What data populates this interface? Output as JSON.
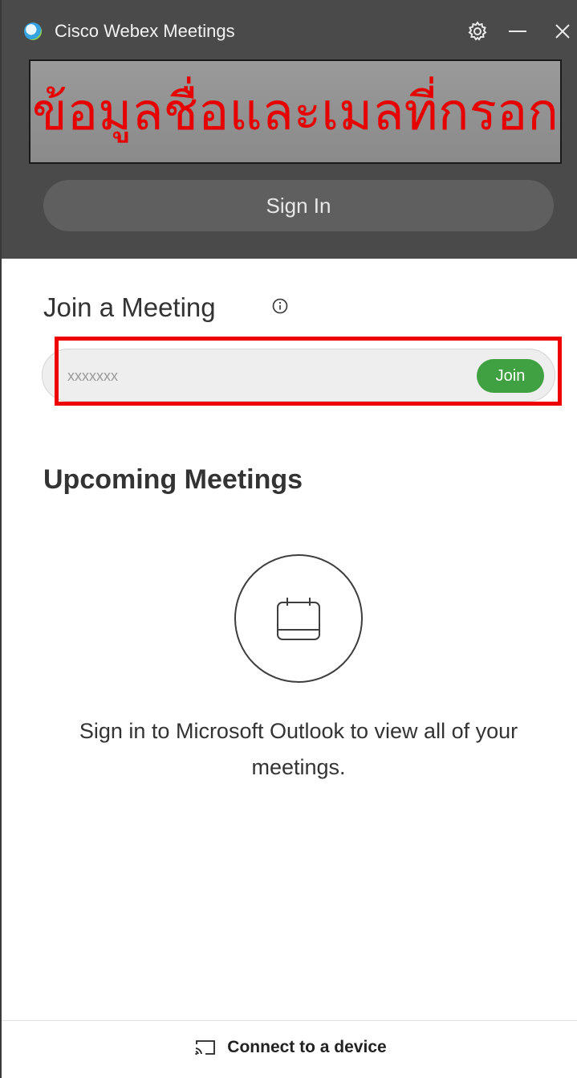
{
  "window": {
    "title": "Cisco Webex Meetings"
  },
  "header": {
    "overlay_text": "ข้อมูลชื่อและเมลที่กรอก",
    "signin_label": "Sign In"
  },
  "join": {
    "title": "Join a Meeting",
    "input_value": "xxxxxxx",
    "join_label": "Join"
  },
  "upcoming": {
    "title": "Upcoming Meetings",
    "empty_message": "Sign in to Microsoft Outlook to view all of your meetings."
  },
  "footer": {
    "connect_label": "Connect to a device"
  },
  "icons": {
    "settings": "gear-icon",
    "minimize": "minimize-icon",
    "close": "close-icon",
    "info": "info-icon",
    "calendar": "calendar-icon",
    "cast": "cast-icon"
  },
  "colors": {
    "header_bg": "#4a4a4a",
    "signin_bg": "#5f5f5f",
    "join_green": "#3fa142",
    "highlight_red": "#ee0000",
    "overlay_text": "#e60000"
  }
}
